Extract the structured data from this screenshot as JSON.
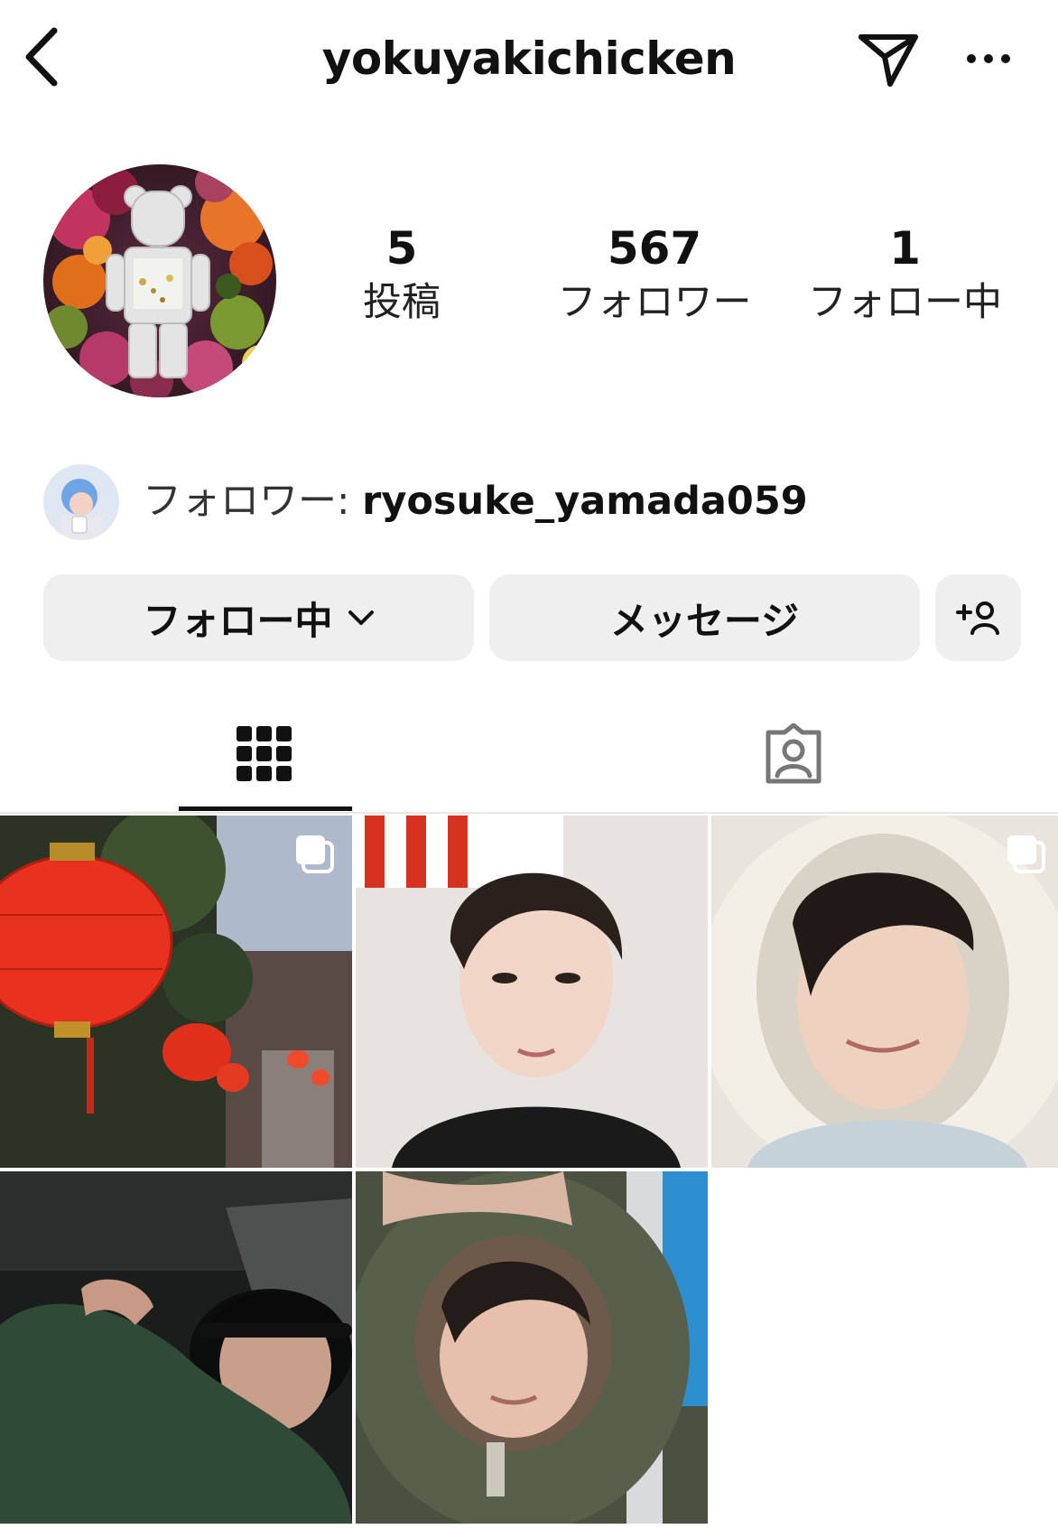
{
  "header": {
    "back_icon": "chevron-left-icon",
    "username": "yokuyakichicken",
    "send_icon": "paper-plane-icon",
    "more_icon": "more-horizontal-icon"
  },
  "profile": {
    "avatar_description": "bearbrick-flowers-avatar",
    "stats": {
      "posts": {
        "value": "5",
        "label": "投稿"
      },
      "followers": {
        "value": "567",
        "label": "フォロワー"
      },
      "following": {
        "value": "1",
        "label": "フォロー中"
      }
    },
    "followed_by": {
      "prefix": "フォロワー: ",
      "username": "ryosuke_yamada059"
    }
  },
  "actions": {
    "following_label": "フォロー中",
    "message_label": "メッセージ",
    "add_user_icon": "add-person-icon"
  },
  "tabs": {
    "grid_icon": "grid-icon",
    "tagged_icon": "tagged-person-icon",
    "active": "grid"
  },
  "posts": [
    {
      "id": 1,
      "multi": true,
      "theme": "red-lanterns-street"
    },
    {
      "id": 2,
      "multi": false,
      "theme": "portrait-black-tee"
    },
    {
      "id": 3,
      "multi": true,
      "theme": "portrait-white-hood"
    },
    {
      "id": 4,
      "multi": false,
      "theme": "portrait-car-bucket-hat"
    },
    {
      "id": 5,
      "multi": false,
      "theme": "portrait-olive-hood"
    }
  ]
}
